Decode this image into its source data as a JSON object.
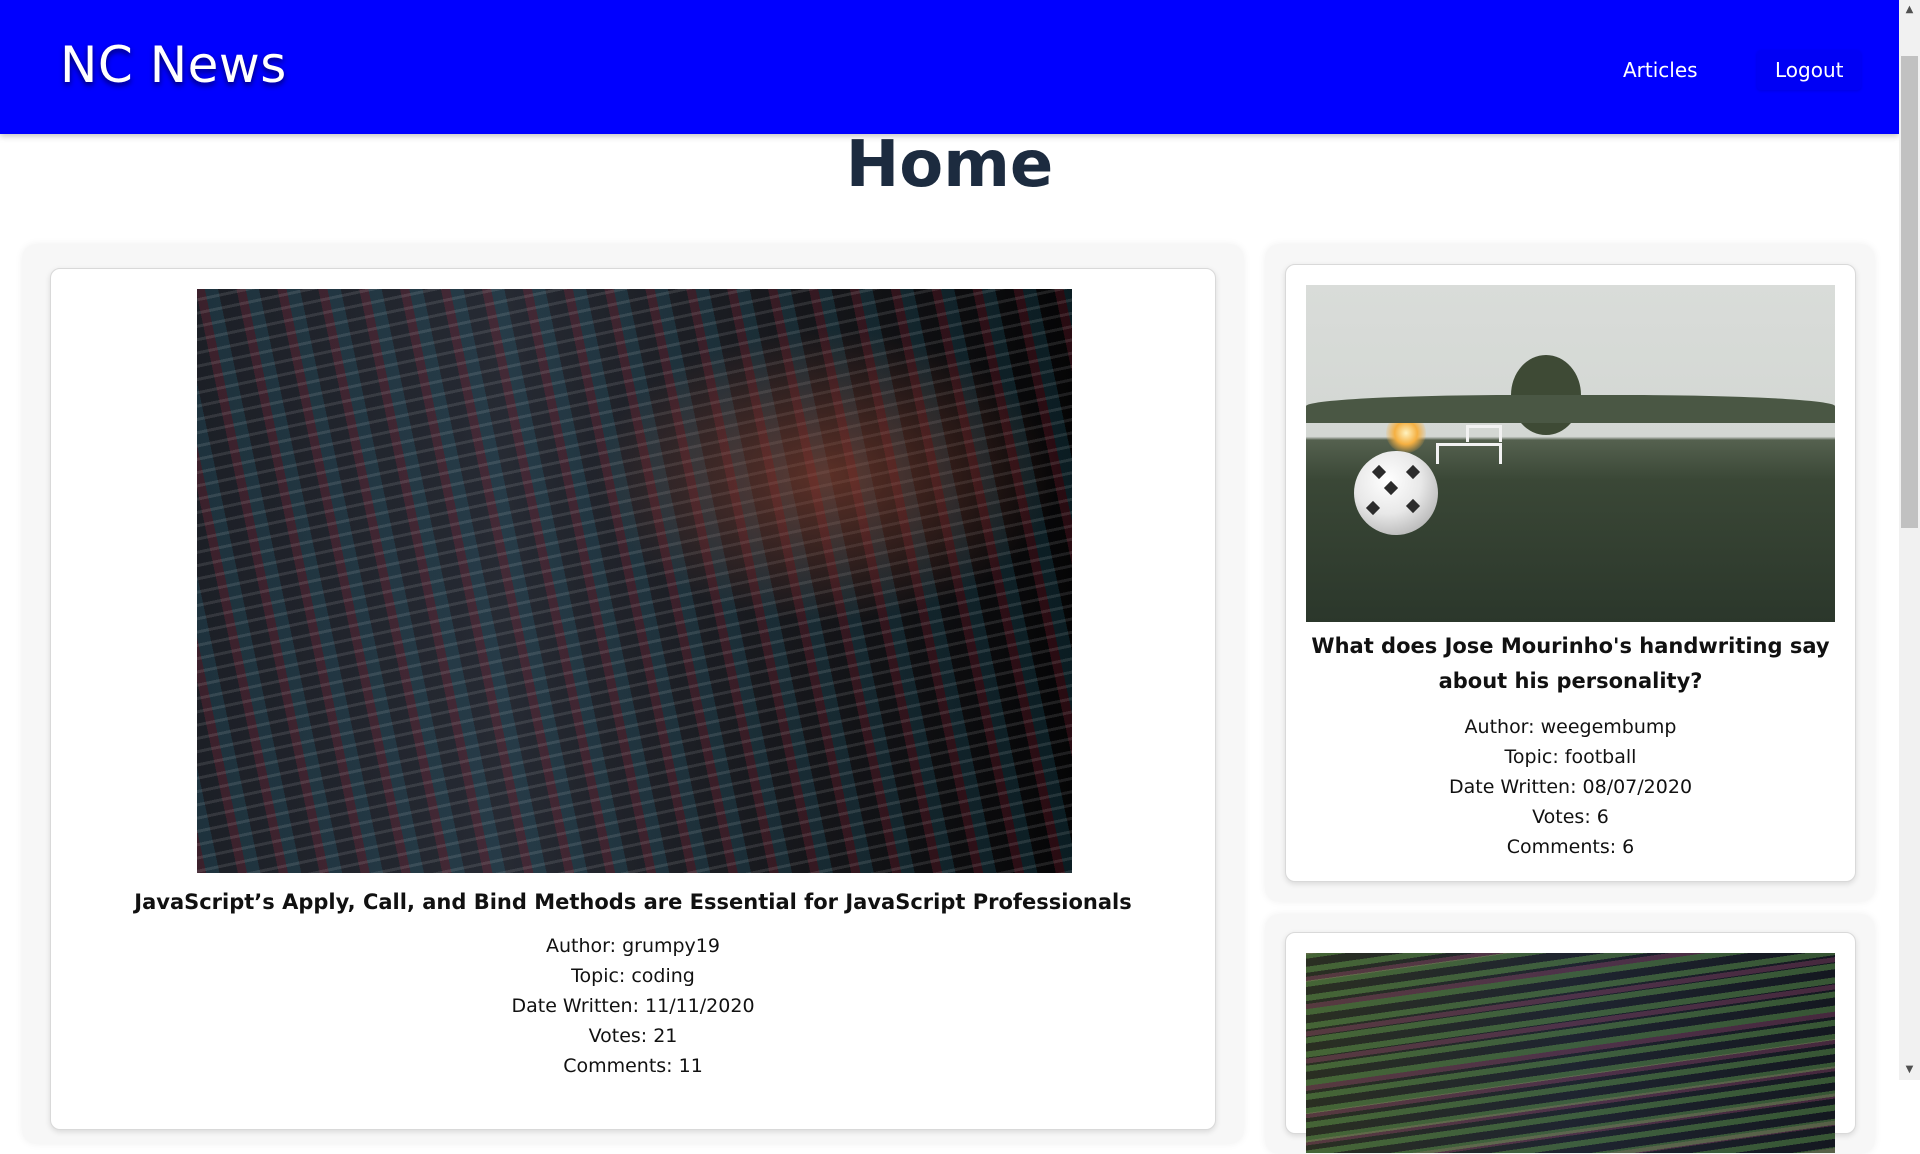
{
  "header": {
    "brand": "NC News",
    "nav": {
      "articles_label": "Articles",
      "logout_label": "Logout"
    }
  },
  "page": {
    "title": "Home"
  },
  "articles": [
    {
      "title": "JavaScript’s Apply, Call, and Bind Methods are Essential for JavaScript Professionals",
      "author_line": "Author: grumpy19",
      "topic_line": "Topic: coding",
      "date_line": "Date Written: 11/11/2020",
      "votes_line": "Votes: 21",
      "comments_line": "Comments: 11"
    },
    {
      "title": "What does Jose Mourinho's handwriting say about his personality?",
      "author_line": "Author: weegembump",
      "topic_line": "Topic: football",
      "date_line": "Date Written: 08/07/2020",
      "votes_line": "Votes: 6",
      "comments_line": "Comments: 6"
    }
  ],
  "icons": {
    "scroll_up": "scroll-up-arrow-icon",
    "scroll_down": "scroll-down-arrow-icon"
  },
  "colors": {
    "navbar": "#0000ff",
    "title": "#1c2b3f"
  }
}
